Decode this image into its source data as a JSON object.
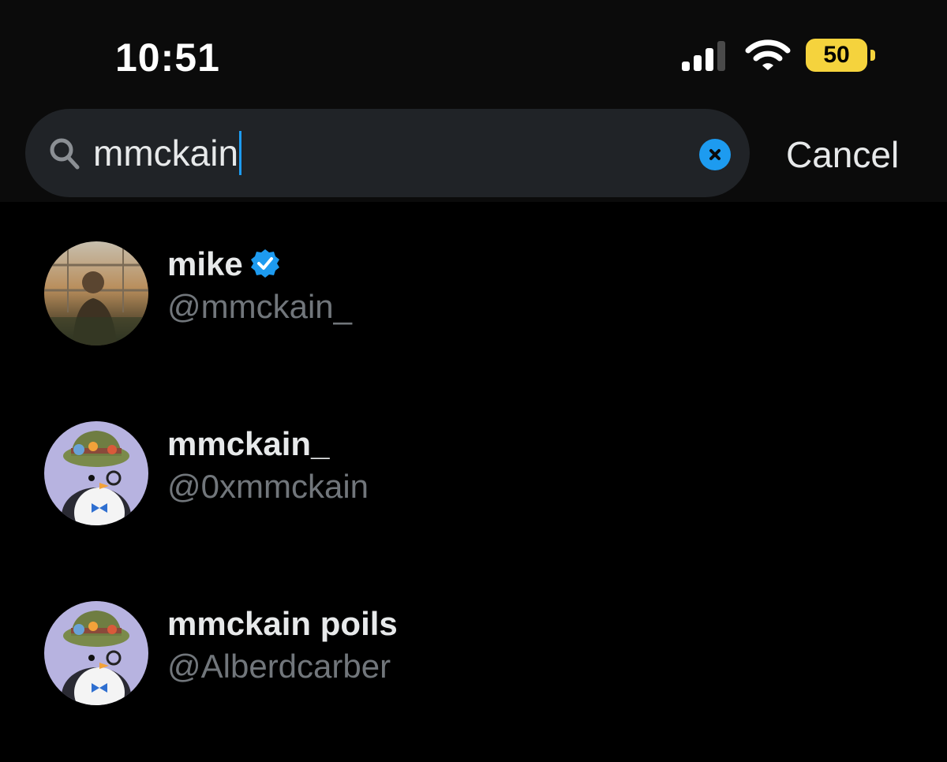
{
  "status_bar": {
    "time": "10:51",
    "battery_level": "50",
    "signal_icon": "cellular-signal-icon",
    "wifi_icon": "wifi-icon",
    "battery_color": "#f5d33d"
  },
  "search": {
    "icon": "search-icon",
    "query": "mmckain",
    "clear_icon": "clear-icon",
    "cancel_label": "Cancel"
  },
  "results": [
    {
      "name": "mike",
      "handle": "@mmckain_",
      "verified": true,
      "avatar": "photo-avatar"
    },
    {
      "name": "mmckain_",
      "handle": "@0xmmckain",
      "verified": false,
      "avatar": "penguin-avatar"
    },
    {
      "name": "mmckain poils",
      "handle": "@Alberdcarber",
      "verified": false,
      "avatar": "penguin-avatar"
    }
  ],
  "colors": {
    "background": "#000000",
    "search_field": "#202327",
    "accent": "#1d9bf0",
    "primary_text": "#e7e9ea",
    "secondary_text": "#71767b"
  }
}
